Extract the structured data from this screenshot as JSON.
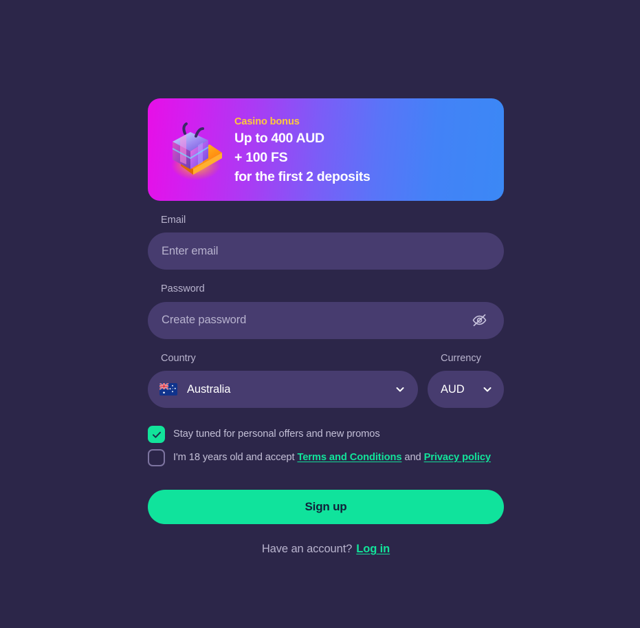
{
  "theme": {
    "page_background": "#2c2649",
    "field_background": "#473c6f",
    "accent_green": "#12e39a",
    "label_color": "#b9b4ce",
    "banner_gradient_from": "#e70fe7",
    "banner_gradient_to": "#3b88f5",
    "banner_kicker_color": "#ffc93c"
  },
  "banner": {
    "icon": "gift-box-icon",
    "kicker": "Casino bonus",
    "lines": [
      "Up to 400 AUD",
      "+ 100 FS",
      "for the first 2 deposits"
    ]
  },
  "form": {
    "email": {
      "label": "Email",
      "placeholder": "Enter email",
      "value": ""
    },
    "password": {
      "label": "Password",
      "placeholder": "Create password",
      "value": "",
      "toggle_icon": "eye-off-icon"
    },
    "country": {
      "label": "Country",
      "value": "Australia",
      "flag": "australia-flag",
      "chevron_icon": "chevron-down-icon"
    },
    "currency": {
      "label": "Currency",
      "value": "AUD",
      "chevron_icon": "chevron-down-icon"
    },
    "checkboxes": [
      {
        "name": "promos",
        "checked": true,
        "text": "Stay tuned for personal offers and new promos"
      },
      {
        "name": "age-terms",
        "checked": false,
        "text_before": "I'm 18 years old and accept ",
        "link_terms": "Terms and Conditions",
        "text_between": " and ",
        "link_privacy": "Privacy policy"
      }
    ],
    "submit_label": "Sign up"
  },
  "footer": {
    "question": "Have an account?",
    "login_label": "Log in"
  }
}
